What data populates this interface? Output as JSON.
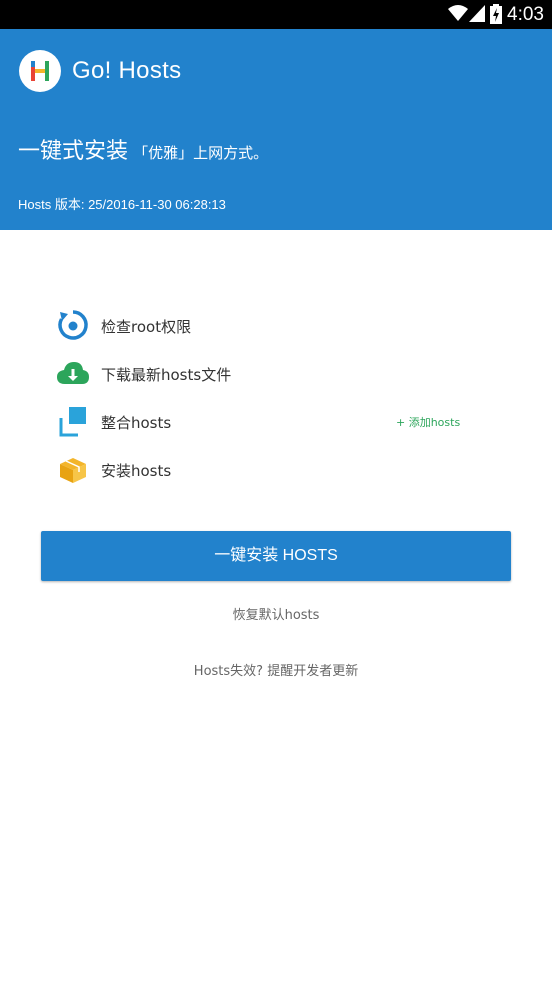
{
  "status_bar": {
    "time": "4:03",
    "icons": [
      "wifi-icon",
      "signal-icon",
      "battery-charging-icon"
    ]
  },
  "header": {
    "app_name": "Go! Hosts",
    "tagline_main": "一键式安装",
    "tagline_sub": "「优雅」上网方式。",
    "version": "Hosts 版本: 25/2016-11-30 06:28:13",
    "background_color": "#2282CC"
  },
  "steps": [
    {
      "label": "检查root权限",
      "icon": "check-root-icon"
    },
    {
      "label": "下载最新hosts文件",
      "icon": "cloud-download-icon"
    },
    {
      "label": "整合hosts",
      "icon": "merge-icon",
      "action": "+ 添加hosts"
    },
    {
      "label": "安装hosts",
      "icon": "package-icon"
    }
  ],
  "install_button": "一键安装 HOSTS",
  "restore_link": "恢复默认hosts",
  "report_link": "Hosts失效? 提醒开发者更新",
  "colors": {
    "accent": "#2282CC",
    "green": "#2CA55B",
    "orange": "#F3B52A"
  }
}
